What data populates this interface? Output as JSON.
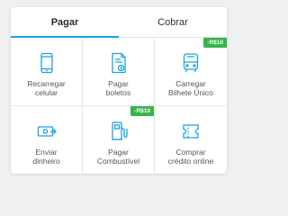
{
  "tabs": [
    {
      "label": "Pagar",
      "active": true
    },
    {
      "label": "Cobrar",
      "active": false
    }
  ],
  "colors": {
    "accent": "#1aa1e6",
    "badge": "#36b54a"
  },
  "items": [
    {
      "line1": "Recarregar",
      "line2": "celular",
      "icon": "phone-icon",
      "badge": ""
    },
    {
      "line1": "Pagar",
      "line2": "boletos",
      "icon": "bill-icon",
      "badge": ""
    },
    {
      "line1": "Carregar",
      "line2": "Bilhete Único",
      "icon": "bus-icon",
      "badge": "-R$10"
    },
    {
      "line1": "Enviar",
      "line2": "dinheiro",
      "icon": "send-money-icon",
      "badge": ""
    },
    {
      "line1": "Pagar",
      "line2": "Combustível",
      "icon": "fuel-pump-icon",
      "badge": "-R$10"
    },
    {
      "line1": "Comprar",
      "line2": "crédito online",
      "icon": "ticket-icon",
      "badge": ""
    }
  ]
}
